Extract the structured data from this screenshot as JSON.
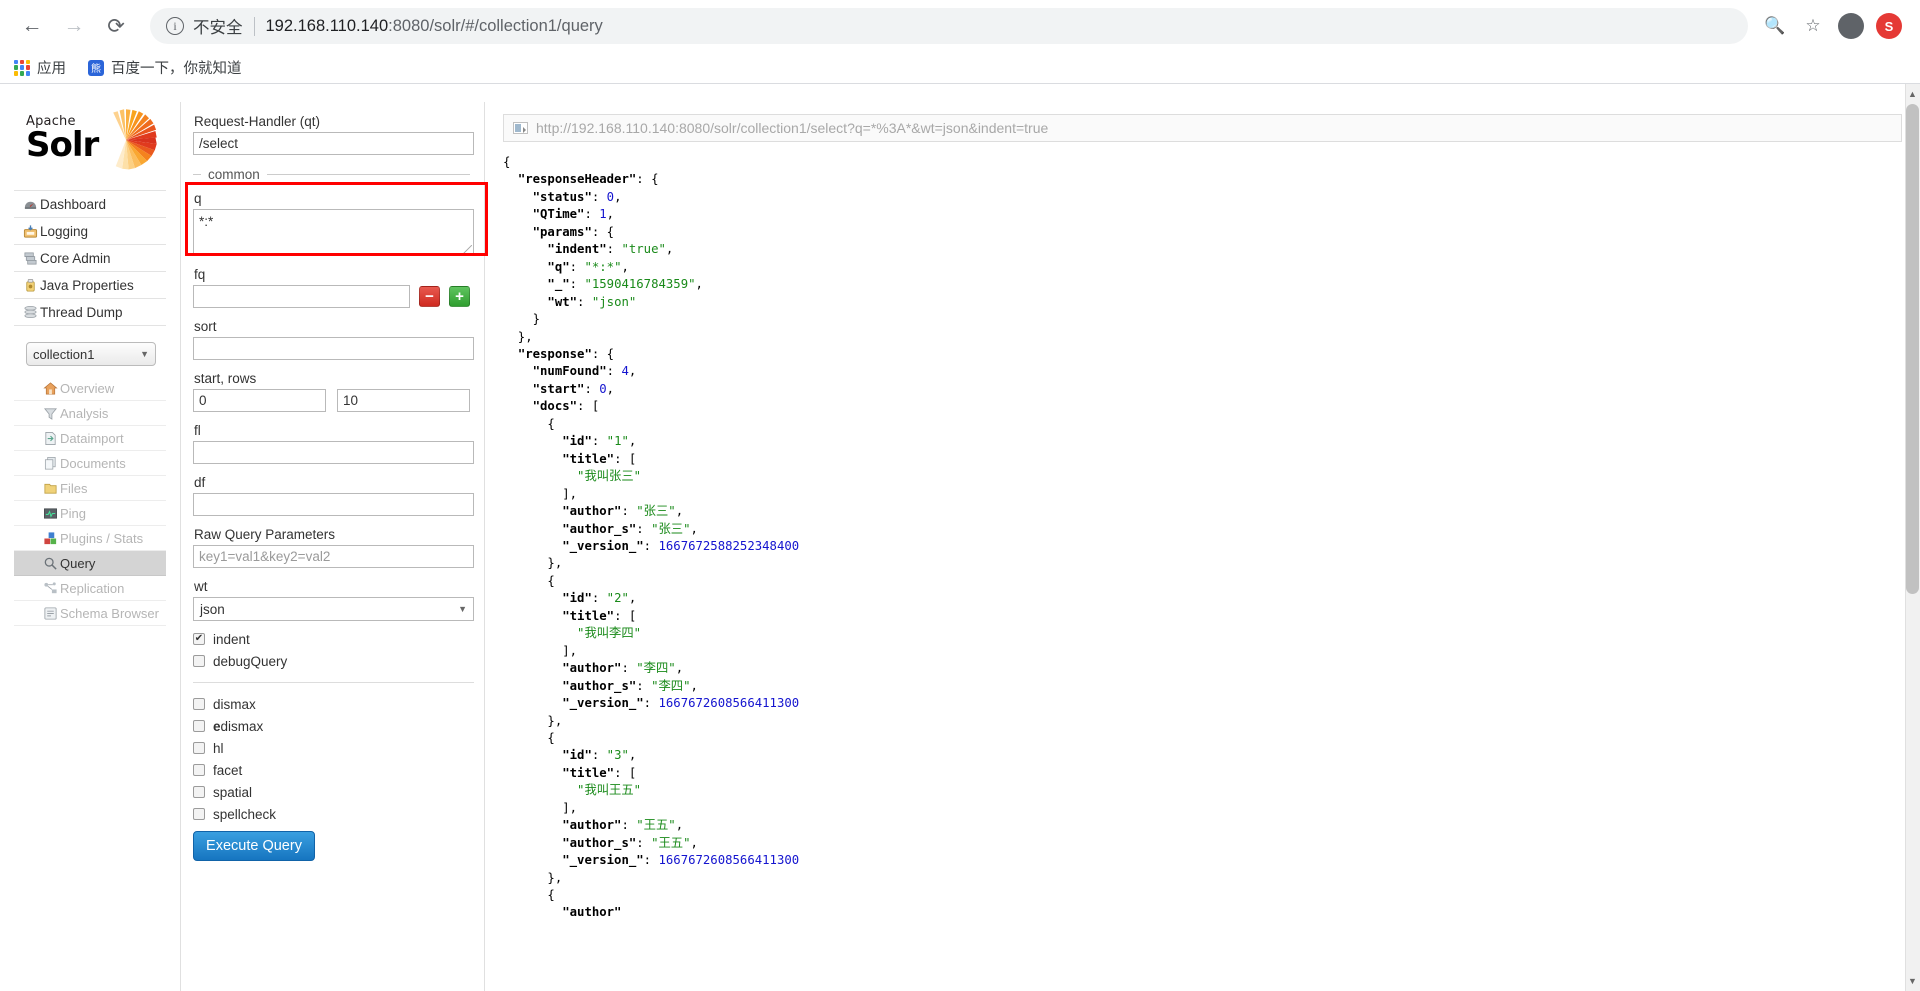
{
  "browser": {
    "back_icon": "back-arrow-icon",
    "forward_icon": "forward-arrow-icon",
    "reload_icon": "reload-icon",
    "security_label": "不安全",
    "url_host": "192.168.110.140",
    "url_path": ":8080/solr/#/collection1/query",
    "zoom_icon": "zoom-icon",
    "bookmark_icon": "star-icon",
    "profile_icon": "profile-avatar-icon",
    "extension_badge": "S",
    "bookmarks": [
      {
        "label": "应用",
        "icon": "apps-grid-icon"
      },
      {
        "label": "百度一下，你就知道",
        "icon": "baidu-icon"
      }
    ]
  },
  "sidebar": {
    "logo": {
      "apache": "Apache",
      "solr": "Solr"
    },
    "main_items": [
      {
        "label": "Dashboard",
        "icon": "dashboard-gauge-icon"
      },
      {
        "label": "Logging",
        "icon": "logging-tray-icon"
      },
      {
        "label": "Core Admin",
        "icon": "core-admin-servers-icon"
      },
      {
        "label": "Java Properties",
        "icon": "java-coffee-icon"
      },
      {
        "label": "Thread Dump",
        "icon": "thread-dump-stack-icon"
      }
    ],
    "core_selector": {
      "value": "collection1",
      "caret": "▼"
    },
    "sub_items": [
      {
        "label": "Overview",
        "icon": "home-icon",
        "active": false
      },
      {
        "label": "Analysis",
        "icon": "funnel-icon",
        "active": false
      },
      {
        "label": "Dataimport",
        "icon": "dataimport-page-icon",
        "active": false
      },
      {
        "label": "Documents",
        "icon": "documents-icon",
        "active": false
      },
      {
        "label": "Files",
        "icon": "folder-icon",
        "active": false
      },
      {
        "label": "Ping",
        "icon": "ping-monitor-icon",
        "active": false
      },
      {
        "label": "Plugins / Stats",
        "icon": "plugins-blocks-icon",
        "active": false
      },
      {
        "label": "Query",
        "icon": "magnifier-icon",
        "active": true
      },
      {
        "label": "Replication",
        "icon": "replication-nodes-icon",
        "active": false
      },
      {
        "label": "Schema Browser",
        "icon": "schema-browser-icon",
        "active": false
      }
    ]
  },
  "query_form": {
    "request_handler_label": "Request-Handler (qt)",
    "request_handler_value": "/select",
    "common_legend": "common",
    "q_label": "q",
    "q_value": "*:*",
    "fq_label": "fq",
    "fq_value": "",
    "fq_remove_label": "−",
    "fq_add_label": "+",
    "sort_label": "sort",
    "sort_value": "",
    "start_rows_label": "start, rows",
    "start_value": "0",
    "rows_value": "10",
    "fl_label": "fl",
    "fl_value": "",
    "df_label": "df",
    "df_value": "",
    "raw_params_label": "Raw Query Parameters",
    "raw_params_placeholder": "key1=val1&key2=val2",
    "wt_label": "wt",
    "wt_value": "json",
    "wt_caret": "▼",
    "checkboxes": [
      {
        "label": "indent",
        "checked": true
      },
      {
        "label": "debugQuery",
        "checked": false
      }
    ],
    "parser_checkboxes": [
      {
        "label": "dismax",
        "checked": false
      },
      {
        "label": "edismax",
        "checked": false,
        "bold_prefix": "e"
      },
      {
        "label": "hl",
        "checked": false
      },
      {
        "label": "facet",
        "checked": false
      },
      {
        "label": "spatial",
        "checked": false
      },
      {
        "label": "spellcheck",
        "checked": false
      }
    ],
    "execute_label": "Execute Query",
    "check_glyph": "✔",
    "highlight_color": "#ff0000"
  },
  "result": {
    "request_url": "http://192.168.110.140:8080/solr/collection1/select?q=*%3A*&wt=json&indent=true",
    "response": {
      "responseHeader": {
        "status": 0,
        "QTime": 1,
        "params": {
          "indent": "true",
          "q": "*:*",
          "_": "1590416784359",
          "wt": "json"
        }
      },
      "response": {
        "numFound": 4,
        "start": 0,
        "docs": [
          {
            "id": "1",
            "title": [
              "我叫张三"
            ],
            "author": "张三",
            "author_s": "张三",
            "_version_": 1667672588252348400
          },
          {
            "id": "2",
            "title": [
              "我叫李四"
            ],
            "author": "李四",
            "author_s": "李四",
            "_version_": 1667672608566411300
          },
          {
            "id": "3",
            "title": [
              "我叫王五"
            ],
            "author": "王五",
            "author_s": "王五",
            "_version_": 1667672608566411301
          }
        ]
      }
    }
  },
  "colors": {
    "json_key": "#000000",
    "json_string": "#1a8a1a",
    "json_number": "#1414cf",
    "accent_button": "#1675c0",
    "highlight": "#ff0000"
  }
}
